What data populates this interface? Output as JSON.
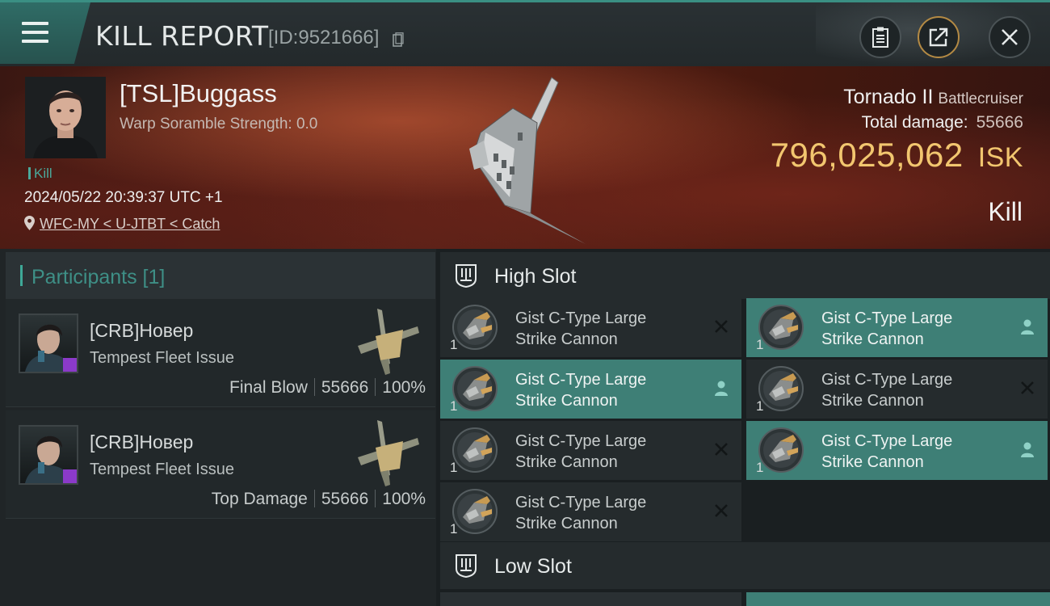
{
  "header": {
    "title": "KILL REPORT",
    "report_id": "[ID:9521666]",
    "icons": [
      "menu-icon",
      "copy-icon",
      "clipboard-icon",
      "share-icon",
      "close-icon"
    ]
  },
  "victim": {
    "pilot_name": "[TSL]Buggass",
    "warp_scramble": "Warp Soramble Strength: 0.0",
    "kill_tag": "Kill",
    "datetime": "2024/05/22 20:39:37 UTC +1",
    "location": "WFC-MY < U-JTBT < Catch",
    "ship_name": "Tornado II",
    "ship_class": "Battlecruiser",
    "total_damage_label": "Total damage:",
    "total_damage": "55666",
    "isk_value": "796,025,062",
    "isk_unit": "ISK",
    "result": "Kill"
  },
  "participants": {
    "title": "Participants [1]",
    "rows": [
      {
        "name": "[CRB]Новер",
        "ship": "Tempest Fleet Issue",
        "role": "Final Blow",
        "damage": "55666",
        "percent": "100%"
      },
      {
        "name": "[CRB]Новер",
        "ship": "Tempest Fleet Issue",
        "role": "Top Damage",
        "damage": "55666",
        "percent": "100%"
      }
    ]
  },
  "fitting": {
    "high_slot_title": "High Slot",
    "low_slot_title": "Low Slot",
    "high_slot": [
      {
        "name_line1": "Gist C-Type Large",
        "name_line2": "Strike Cannon",
        "qty": "1",
        "status": "destroyed"
      },
      {
        "name_line1": "Gist C-Type Large",
        "name_line2": "Strike Cannon",
        "qty": "1",
        "status": "dropped"
      },
      {
        "name_line1": "Gist C-Type Large",
        "name_line2": "Strike Cannon",
        "qty": "1",
        "status": "dropped"
      },
      {
        "name_line1": "Gist C-Type Large",
        "name_line2": "Strike Cannon",
        "qty": "1",
        "status": "destroyed"
      },
      {
        "name_line1": "Gist C-Type Large",
        "name_line2": "Strike Cannon",
        "qty": "1",
        "status": "destroyed"
      },
      {
        "name_line1": "Gist C-Type Large",
        "name_line2": "Strike Cannon",
        "qty": "1",
        "status": "dropped"
      },
      {
        "name_line1": "Gist C-Type Large",
        "name_line2": "Strike Cannon",
        "qty": "1",
        "status": "destroyed"
      }
    ]
  },
  "colors": {
    "accent_teal": "#3e7f76",
    "isk_gold": "#f2c66f",
    "header_bg": "#23292b"
  }
}
